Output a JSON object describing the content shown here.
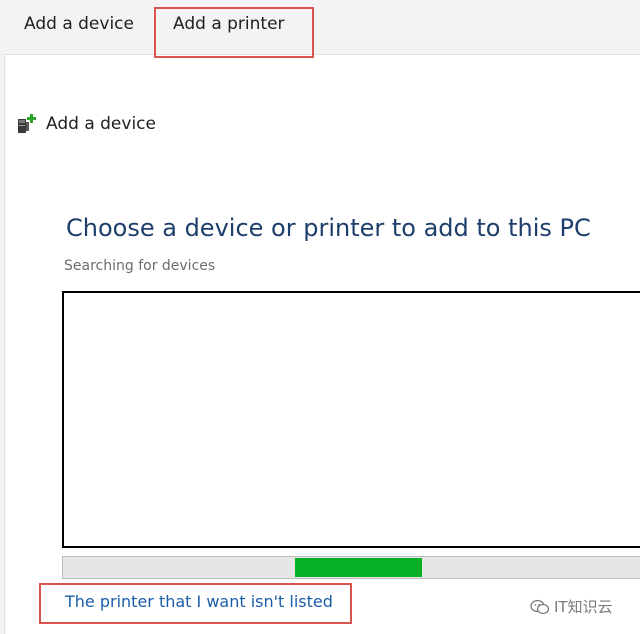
{
  "toolbar": {
    "add_device_label": "Add a device",
    "add_printer_label": "Add a printer"
  },
  "dialog": {
    "window_title": "Add a device",
    "heading": "Choose a device or printer to add to this PC",
    "status": "Searching for devices",
    "device_list": [],
    "link_label": "The printer that I want isn't listed"
  },
  "watermark": {
    "text": "IT知识云"
  },
  "colors": {
    "heading": "#1e3e6b",
    "link": "#1a5ea8",
    "progress": "#06b025",
    "highlight": "#d9534f"
  },
  "icons": {
    "window_icon": "device-with-plus-icon",
    "watermark_icon": "wechat-icon"
  }
}
